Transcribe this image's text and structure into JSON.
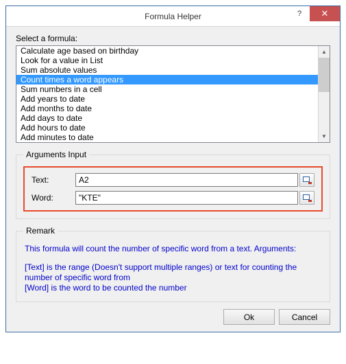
{
  "titlebar": {
    "title": "Formula Helper",
    "help_symbol": "?",
    "close_symbol": "✕"
  },
  "select_formula": {
    "label": "Select a formula:",
    "items": [
      "Calculate age based on birthday",
      "Look for a value in List",
      "Sum absolute values",
      "Count times a word appears",
      "Sum numbers in a cell",
      "Add years to date",
      "Add months to date",
      "Add days to date",
      "Add hours to date",
      "Add minutes to date"
    ],
    "selected_index": 3
  },
  "arguments": {
    "legend": "Arguments Input",
    "rows": [
      {
        "label": "Text:",
        "value": "A2"
      },
      {
        "label": "Word:",
        "value": "\"KTE\""
      }
    ]
  },
  "remark": {
    "legend": "Remark",
    "line1": "This formula will count the number of specific word from a text. Arguments:",
    "line2": "[Text] is the range (Doesn't support multiple ranges) or text for counting the number of specific word from",
    "line3": "[Word] is the word to be counted the number"
  },
  "buttons": {
    "ok": "Ok",
    "cancel": "Cancel"
  }
}
